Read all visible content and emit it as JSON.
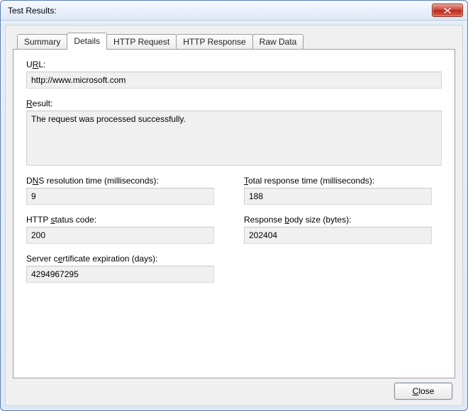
{
  "window": {
    "title": "Test Results:"
  },
  "tabs": {
    "summary": "Summary",
    "details": "Details",
    "http_request": "HTTP Request",
    "http_response": "HTTP Response",
    "raw_data": "Raw Data",
    "active": "details"
  },
  "labels": {
    "url_pre": "U",
    "url_ul": "R",
    "url_post": "L:",
    "result_ul": "R",
    "result_post": "esult:",
    "dns_pre": "D",
    "dns_ul": "N",
    "dns_post": "S resolution time (milliseconds):",
    "total_ul": "T",
    "total_post": "otal response time (milliseconds):",
    "httpstatus_pre": "HTTP ",
    "httpstatus_ul": "s",
    "httpstatus_post": "tatus code:",
    "bodysize_pre": "Response ",
    "bodysize_ul": "b",
    "bodysize_post": "ody size (bytes):",
    "cert_pre": "Server c",
    "cert_ul": "e",
    "cert_post": "rtificate expiration (days):",
    "close_ul": "C",
    "close_post": "lose"
  },
  "values": {
    "url": "http://www.microsoft.com",
    "result": "The request was processed successfully.",
    "dns_ms": "9",
    "total_ms": "188",
    "http_status": "200",
    "body_size": "202404",
    "cert_expiration": "4294967295"
  }
}
